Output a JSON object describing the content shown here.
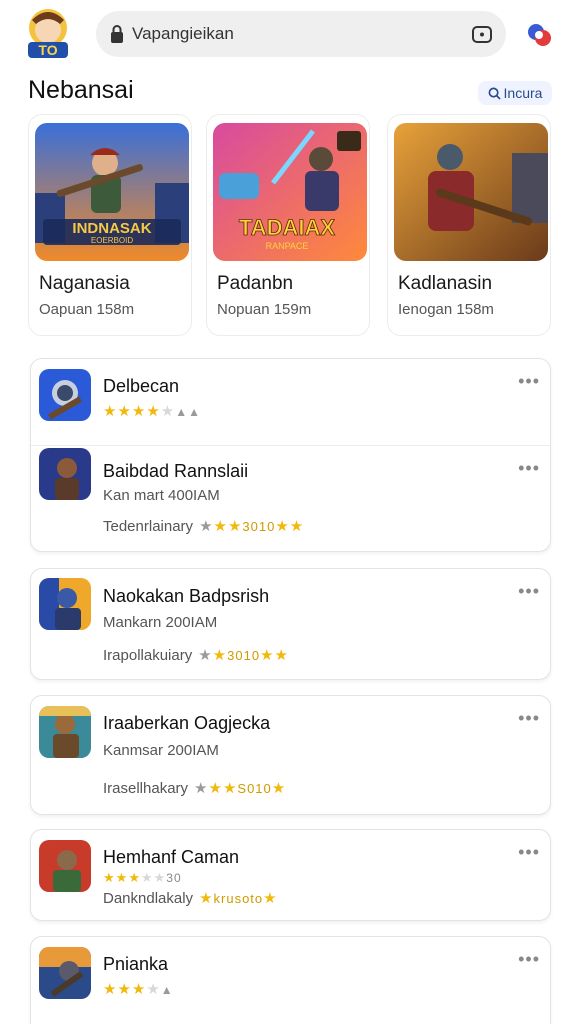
{
  "header": {
    "logo_text": "TO",
    "search_value": "Vapangieikan",
    "search_placeholder": "Vapangieikan"
  },
  "section": {
    "title": "Nebansai",
    "inquire_label": "Incura"
  },
  "featured": [
    {
      "name": "Naganasia",
      "meta": "Oapuan 158m",
      "art_text": "INDNASAK",
      "art_sub": "EOERBOID"
    },
    {
      "name": "Padanbn",
      "meta": "Nopuan 159m",
      "art_text": "TADAIAX",
      "art_sub": "RANPACE"
    },
    {
      "name": "Kadlanasin",
      "meta": "Ienogan 158m",
      "art_text": "",
      "art_sub": ""
    }
  ],
  "list": {
    "panel1": [
      {
        "title": "Delbecan",
        "rating": 3.5
      },
      {
        "title": "Baibdad Rannslaii",
        "sub": "Kan mart 400IAM",
        "rating_label": "Tedenrlainary",
        "rating_num": "3010"
      }
    ],
    "panel2": {
      "title": "Naokakan Badpsrish",
      "sub": "Mankarn 200IAM",
      "rating_label": "Irapollakuiary",
      "rating_num": "3010"
    },
    "panel3": {
      "title": "Iraaberkan Oagjecka",
      "sub": "Kanmsar 200IAM",
      "rating_label": "Irasellhakary",
      "rating_num": "S010"
    },
    "panel4": {
      "title": "Hemhanf Caman",
      "rating": 3.5,
      "rating_num_small": "30",
      "rating_label": "Dankndlakaly",
      "rating_num": "krusoto"
    },
    "panel5": {
      "title": "Pnianka",
      "rating": 3.5
    }
  },
  "colors": {
    "accent": "#2a4a8f",
    "star": "#f0b90b",
    "search_bg": "#efefef"
  },
  "icons": [
    "lock-icon",
    "camera-icon",
    "search-icon",
    "more-dots-icon",
    "star-icon"
  ]
}
